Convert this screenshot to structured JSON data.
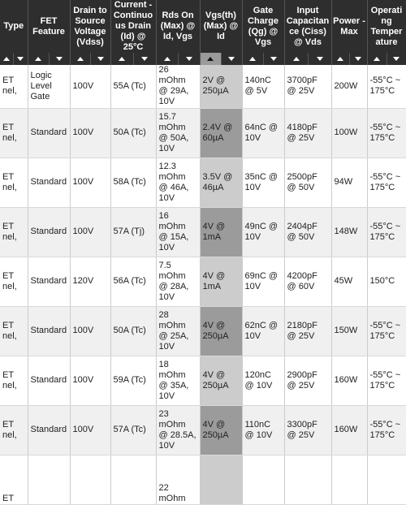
{
  "columns": [
    {
      "label": "Type",
      "key": "type"
    },
    {
      "label": "FET Feature",
      "key": "feature"
    },
    {
      "label": "Drain to Source Voltage (Vdss)",
      "key": "vdss"
    },
    {
      "label": "Current - Continuous Drain (Id) @ 25°C",
      "key": "id"
    },
    {
      "label": "Rds On (Max) @ Id, Vgs",
      "key": "rds"
    },
    {
      "label": "Vgs(th) (Max) @ Id",
      "key": "vgs"
    },
    {
      "label": "Gate Charge (Qg) @ Vgs",
      "key": "qg"
    },
    {
      "label": "Input Capacitance (Ciss) @ Vds",
      "key": "ciss"
    },
    {
      "label": "Power - Max",
      "key": "power"
    },
    {
      "label": "Operating Temperature",
      "key": "temp"
    }
  ],
  "active_sort": {
    "column": "Vgs(th) (Max) @ Id",
    "direction": "ascending"
  },
  "colors": {
    "header_bg": "#2e2e2e",
    "sorted_col_light": "#cccccc",
    "sorted_col_dark": "#9b9b9b",
    "row_alt": "#f0f0f0"
  },
  "rows": [
    {
      "type": "ET nel,",
      "feature": "Logic Level Gate",
      "vdss": "100V",
      "id": "55A (Tc)",
      "rds": "26 mOhm @ 29A, 10V",
      "vgs": "2V @ 250µA",
      "qg": "140nC @ 5V",
      "ciss": "3700pF @ 25V",
      "power": "200W",
      "temp": "-55°C ~ 175°C"
    },
    {
      "type": "ET nel,",
      "feature": "Standard",
      "vdss": "100V",
      "id": "50A (Tc)",
      "rds": "15.7 mOhm @ 50A, 10V",
      "vgs": "2.4V @ 60µA",
      "qg": "64nC @ 10V",
      "ciss": "4180pF @ 25V",
      "power": "100W",
      "temp": "-55°C ~ 175°C"
    },
    {
      "type": "ET nel,",
      "feature": "Standard",
      "vdss": "100V",
      "id": "58A (Tc)",
      "rds": "12.3 mOhm @ 46A, 10V",
      "vgs": "3.5V @ 46µA",
      "qg": "35nC @ 10V",
      "ciss": "2500pF @ 50V",
      "power": "94W",
      "temp": "-55°C ~ 175°C"
    },
    {
      "type": "ET nel,",
      "feature": "Standard",
      "vdss": "100V",
      "id": "57A (Tj)",
      "rds": "16 mOhm @ 15A, 10V",
      "vgs": "4V @ 1mA",
      "qg": "49nC @ 10V",
      "ciss": "2404pF @ 50V",
      "power": "148W",
      "temp": "-55°C ~ 175°C"
    },
    {
      "type": "ET nel,",
      "feature": "Standard",
      "vdss": "120V",
      "id": "56A (Tc)",
      "rds": "7.5 mOhm @ 28A, 10V",
      "vgs": "4V @ 1mA",
      "qg": "69nC @ 10V",
      "ciss": "4200pF @ 60V",
      "power": "45W",
      "temp": "150°C"
    },
    {
      "type": "ET nel,",
      "feature": "Standard",
      "vdss": "100V",
      "id": "50A (Tc)",
      "rds": "28 mOhm @ 25A, 10V",
      "vgs": "4V @ 250µA",
      "qg": "62nC @ 10V",
      "ciss": "2180pF @ 25V",
      "power": "150W",
      "temp": "-55°C ~ 175°C"
    },
    {
      "type": "ET nel,",
      "feature": "Standard",
      "vdss": "100V",
      "id": "59A (Tc)",
      "rds": "18 mOhm @ 35A, 10V",
      "vgs": "4V @ 250µA",
      "qg": "120nC @ 10V",
      "ciss": "2900pF @ 25V",
      "power": "160W",
      "temp": "-55°C ~ 175°C"
    },
    {
      "type": "ET nel,",
      "feature": "Standard",
      "vdss": "100V",
      "id": "57A (Tc)",
      "rds": "23 mOhm @ 28.5A, 10V",
      "vgs": "4V @ 250µA",
      "qg": "110nC @ 10V",
      "ciss": "3300pF @ 25V",
      "power": "160W",
      "temp": "-55°C ~ 175°C"
    },
    {
      "type": "ET",
      "feature": "",
      "vdss": "",
      "id": "",
      "rds": "22 mOhm",
      "vgs": "",
      "qg": "",
      "ciss": "",
      "power": "",
      "temp": ""
    }
  ]
}
